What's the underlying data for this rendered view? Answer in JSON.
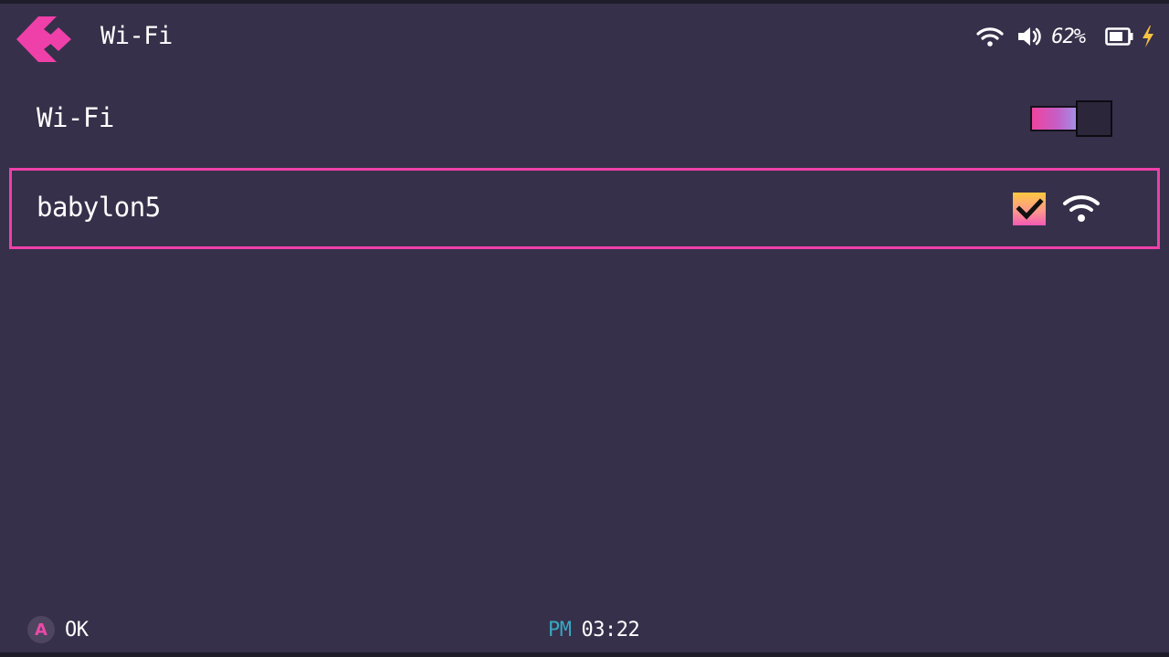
{
  "header": {
    "title": "Wi-Fi",
    "back_icon": "back-chevron-icon"
  },
  "status": {
    "battery_percent": "62%",
    "icons": [
      "wifi-icon",
      "volume-icon",
      "battery-icon",
      "charging-bolt-icon"
    ],
    "charging_color": "#f5c242"
  },
  "settings": {
    "wifi_label": "Wi-Fi",
    "wifi_enabled": true
  },
  "networks": [
    {
      "ssid": "babylon5",
      "connected": true,
      "signal_icon": "wifi-signal-icon",
      "selected": true
    }
  ],
  "footer": {
    "button_glyph": "A",
    "button_action": "OK",
    "time_meridiem": "PM",
    "time": "03:22"
  },
  "colors": {
    "accent": "#ef40a9",
    "background": "#37304a",
    "meridiem": "#38a7c2"
  }
}
